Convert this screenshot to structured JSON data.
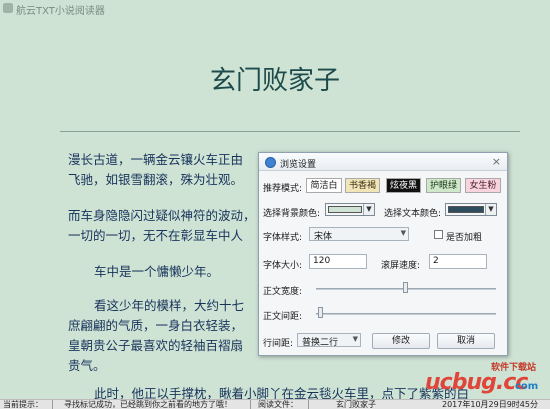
{
  "app": {
    "title": "航云TXT小说阅读器"
  },
  "book": {
    "title": "玄门败家子",
    "paragraphs": [
      [
        "漫长古道，一辆金云镶火车正由",
        "飞驰，如银雪翻滚，殊为壮观。"
      ],
      [
        "而车身隐隐闪过疑似神符的波动，",
        "一切的一切，无不在彰显车中人"
      ],
      [
        "车中是一个慵懒少年。"
      ],
      [
        "看这少年的模样，大约十七",
        "庶翩翩的气质，一身白衣轻装，",
        "皇朝贵公子最喜欢的轻袖百褶扇",
        "贵气。"
      ],
      [
        "此时，他正以手撑枕，瞅着小脚丫在金云毯火车里，点下了紫紫的白"
      ]
    ]
  },
  "dialog": {
    "title": "浏览设置",
    "close_label": "×",
    "preset_label": "推荐模式:",
    "presets": [
      {
        "label": "简洁白",
        "bg": "#ffffff",
        "fg": "#1a1a1a"
      },
      {
        "label": "书香褐",
        "bg": "#f1e6b8",
        "fg": "#3a2a10"
      },
      {
        "label": "炫夜黑",
        "bg": "#111111",
        "fg": "#ffffff"
      },
      {
        "label": "护眼绿",
        "bg": "#cfe8c9",
        "fg": "#1a3a1a"
      },
      {
        "label": "女生粉",
        "bg": "#f7d4de",
        "fg": "#4a1a2a"
      }
    ],
    "bg_color_label": "选择背景颜色:",
    "bg_color": "#cfe3d5",
    "text_color_label": "选择文本颜色:",
    "text_color": "#2e4e5f",
    "font_style_label": "字体样式:",
    "font_style_value": "宋体",
    "bold_label": "是否加粗",
    "font_size_label": "字体大小:",
    "font_size_value": "120",
    "scroll_speed_label": "滚屏速度:",
    "scroll_speed_value": "2",
    "body_width_label": "正文宽度:",
    "body_width_fraction": 0.5,
    "body_spacing_label": "正文间距:",
    "body_spacing_fraction": 0.03,
    "line_spacing_label": "行间距:",
    "line_spacing_value": "普换二行",
    "modify_button": "修改",
    "cancel_button": "取消"
  },
  "status_bar": {
    "hint_label": "当前提示：",
    "hint_text": "寻找标记成功，已经跳到你之前看的地方了哦！",
    "reading_label": "阅读文件：",
    "reading_file": "玄门败家子",
    "datetime": "2017年10月29日9时45分"
  },
  "watermark": {
    "main": "ucbug.cc",
    "subtitle": "软件下载站",
    "domain": "com"
  }
}
